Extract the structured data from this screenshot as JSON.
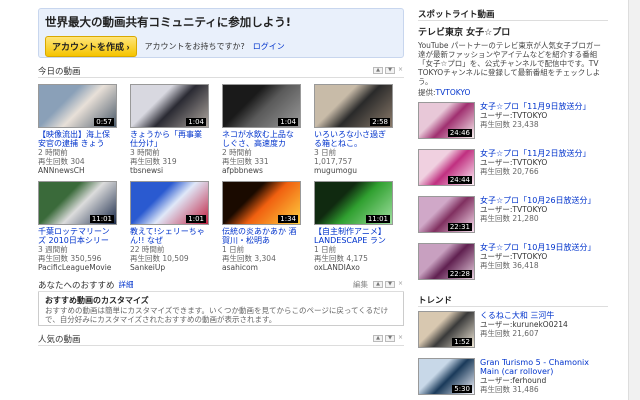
{
  "banner": {
    "title": "世界最大の動画共有コミュニティに参加しよう!",
    "create_button": "アカウントを作成 ›",
    "has_account": "アカウントをお持ちですか?",
    "login": "ログイン"
  },
  "today": {
    "title": "今日の動画",
    "videos": [
      {
        "title": "【映像流出】海上保安官の逮捕 きょう",
        "age": "2 時間前",
        "views": "再生回数 304",
        "user": "ANNnewsCH",
        "duration": "0:57",
        "palette": [
          "#8aa0b8",
          "#e8e0d8",
          "#4a5a6a"
        ]
      },
      {
        "title": "きょうから「再事業仕分け」",
        "age": "3 時間前",
        "views": "再生回数 319",
        "user": "tbsnewsi",
        "duration": "1:04",
        "palette": [
          "#d8d8e0",
          "#2a2a33",
          "#b0a8a0"
        ]
      },
      {
        "title": "ネコが水飲む上品なしぐさ、高速度カ",
        "age": "2 時間前",
        "views": "再生回数 331",
        "user": "afpbbnews",
        "duration": "1:04",
        "palette": [
          "#1a1a1a",
          "#5a5a5a",
          "#9a9a9a"
        ]
      },
      {
        "title": "いろいろな小さ過ぎる箱とねこ。",
        "age": "3 日前",
        "views": "1,017,757",
        "user": "mugumogu",
        "duration": "2:58",
        "palette": [
          "#c8bba8",
          "#2a2a2a",
          "#8a7a6a"
        ]
      },
      {
        "title": "千葉ロッテマリーンズ 2010日本シリー",
        "age": "3 週間前",
        "views": "再生回数 350,596",
        "user": "PacificLeagueMovie",
        "duration": "11:01",
        "palette": [
          "#3a6a3a",
          "#dcdcdc",
          "#1a2a4a"
        ]
      },
      {
        "title": "教えて!シェリーちゃん!! なぜ",
        "age": "22 時間前",
        "views": "再生回数 10,509",
        "user": "SankeiUp",
        "duration": "1:01",
        "palette": [
          "#2a5ad0",
          "#e0e8f8",
          "#c02040"
        ]
      },
      {
        "title": "伝統の炎あかあか 酒賀川・松明あ",
        "age": "1 日前",
        "views": "再生回数 3,304",
        "user": "asahicom",
        "duration": "1:34",
        "palette": [
          "#1a0a00",
          "#f06010",
          "#ffd040"
        ]
      },
      {
        "title": "【自主制作アニメ】LANDESCAPE ラン",
        "age": "1 日前",
        "views": "再生回数 4,175",
        "user": "oxLANDIAxo",
        "duration": "11:01",
        "palette": [
          "#102a10",
          "#30a030",
          "#a0e0a0"
        ]
      }
    ]
  },
  "recommend": {
    "title": "あなたへのおすすめ",
    "detail": "詳細",
    "edit": "編集",
    "box_title": "おすすめ動画のカスタマイズ",
    "box_text1": "おすすめの動画は簡単にカスタマイズできます。いくつか動画を見てからこのページに戻ってくるだけ",
    "box_text2": "で、自分好みにカスタマイズされたおすすめの動画が表示されます。"
  },
  "popular": {
    "title": "人気の動画"
  },
  "spotlight": {
    "header": "スポットライト動画",
    "title": "テレビ東京 女子☆プロ",
    "desc": "YouTube パートナーのテレビ東京が人気女子ブロガー達が最新ファッションやアイテムなどを紹介する番組「女子☆プロ」を、公式チャンネルで配信中です。TV TOKYOチャンネルに登録して最新番組をチェックしよう。",
    "provider_label": "提供:",
    "provider": "TVTOKYO",
    "items": [
      {
        "title": "女子☆プロ「11月9日放送分」",
        "user_label": "ユーザー:",
        "user": "TVTOKYO",
        "views": "再生回数 23,438",
        "duration": "24:46",
        "palette": [
          "#e8c8d8",
          "#a03070",
          "#f8f0f0"
        ]
      },
      {
        "title": "女子☆プロ「11月2日放送分」",
        "user_label": "ユーザー:",
        "user": "TVTOKYO",
        "views": "再生回数 20,766",
        "duration": "24:44",
        "palette": [
          "#f0d0e0",
          "#c03080",
          "#fff0f8"
        ]
      },
      {
        "title": "女子☆プロ「10月26日放送分」",
        "user_label": "ユーザー:",
        "user": "TVTOKYO",
        "views": "再生回数 21,280",
        "duration": "22:31",
        "palette": [
          "#d0a8c8",
          "#803060",
          "#f8e0f0"
        ]
      },
      {
        "title": "女子☆プロ「10月19日放送分」",
        "user_label": "ユーザー:",
        "user": "TVTOKYO",
        "views": "再生回数 36,418",
        "duration": "22:28",
        "palette": [
          "#c8a0c0",
          "#602050",
          "#e8d0e0"
        ]
      }
    ]
  },
  "trend": {
    "header": "トレンド",
    "items": [
      {
        "title": "くるねこ大和 三河牛",
        "user_label": "ユーザー:",
        "user": "kurunekO0214",
        "views": "再生回数 21,607",
        "duration": "1:52",
        "palette": [
          "#d8c8b0",
          "#3a3a3a",
          "#f0e8d8"
        ]
      },
      {
        "title": "Gran Turismo 5 - Chamonix Main (car rollover)",
        "user_label": "ユーザー:",
        "user": "ferhound",
        "views": "再生回数 31,486",
        "duration": "5:30",
        "palette": [
          "#c8d8e8",
          "#1a3a5a",
          "#f8f8ff"
        ]
      }
    ]
  }
}
